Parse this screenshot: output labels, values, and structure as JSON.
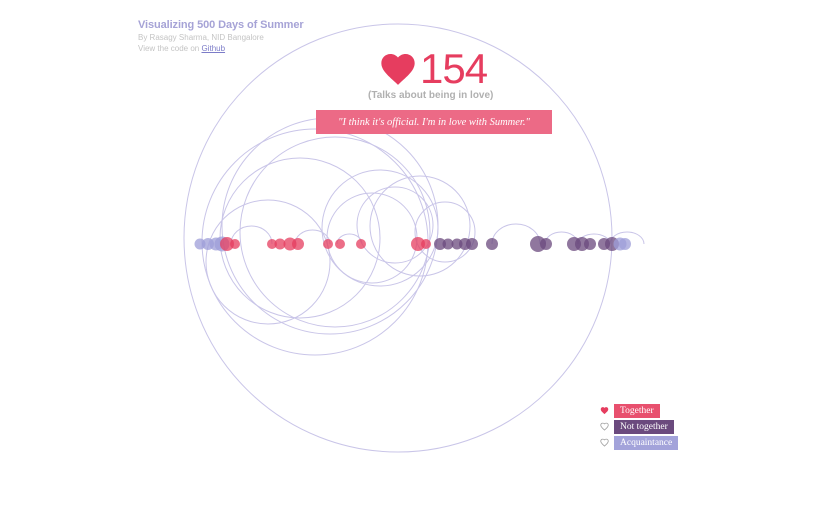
{
  "header": {
    "title": "Visualizing 500 Days of Summer",
    "byline": "By Rasagy Sharma, NID Bangalore",
    "code_prefix": "View the code on",
    "code_link": "Github"
  },
  "count": "154",
  "subtitle": "(Talks about being in love)",
  "quote": "\"I think it's official. I'm in love with Summer.\"",
  "colors": {
    "together": "#e63d5f",
    "not_together": "#6b4a7e",
    "acquaintance": "#9d9dd8",
    "arc": "#c9c5e8",
    "accent": "#e63d5f"
  },
  "legend": [
    {
      "label": "Together",
      "color": "#e8506e",
      "icon": "heart-filled-icon"
    },
    {
      "label": "Not together",
      "color": "#6b4a7e",
      "icon": "heart-outline-icon"
    },
    {
      "label": "Acquaintance",
      "color": "#a3a3da",
      "icon": "heart-outline-icon"
    }
  ]
}
